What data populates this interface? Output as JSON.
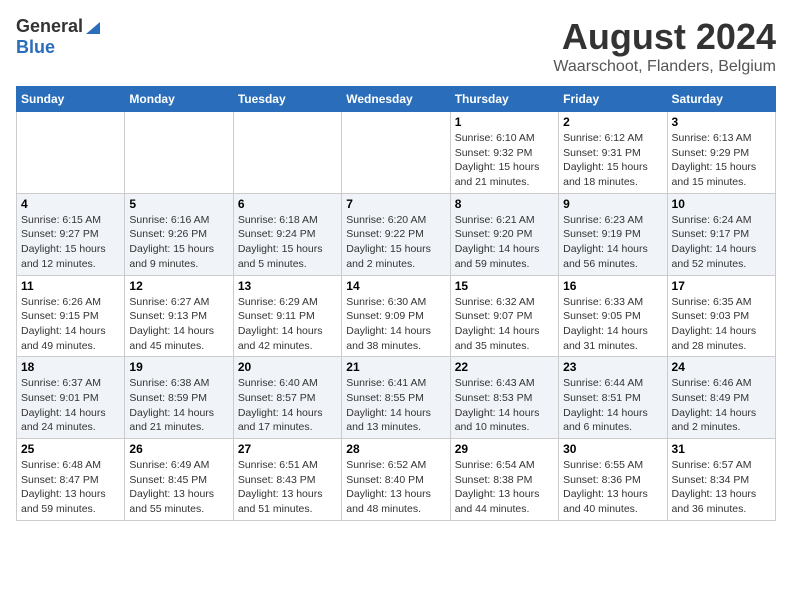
{
  "header": {
    "logo_general": "General",
    "logo_blue": "Blue",
    "month_title": "August 2024",
    "location": "Waarschoot, Flanders, Belgium"
  },
  "weekdays": [
    "Sunday",
    "Monday",
    "Tuesday",
    "Wednesday",
    "Thursday",
    "Friday",
    "Saturday"
  ],
  "weeks": [
    [
      {
        "day": "",
        "info": ""
      },
      {
        "day": "",
        "info": ""
      },
      {
        "day": "",
        "info": ""
      },
      {
        "day": "",
        "info": ""
      },
      {
        "day": "1",
        "info": "Sunrise: 6:10 AM\nSunset: 9:32 PM\nDaylight: 15 hours\nand 21 minutes."
      },
      {
        "day": "2",
        "info": "Sunrise: 6:12 AM\nSunset: 9:31 PM\nDaylight: 15 hours\nand 18 minutes."
      },
      {
        "day": "3",
        "info": "Sunrise: 6:13 AM\nSunset: 9:29 PM\nDaylight: 15 hours\nand 15 minutes."
      }
    ],
    [
      {
        "day": "4",
        "info": "Sunrise: 6:15 AM\nSunset: 9:27 PM\nDaylight: 15 hours\nand 12 minutes."
      },
      {
        "day": "5",
        "info": "Sunrise: 6:16 AM\nSunset: 9:26 PM\nDaylight: 15 hours\nand 9 minutes."
      },
      {
        "day": "6",
        "info": "Sunrise: 6:18 AM\nSunset: 9:24 PM\nDaylight: 15 hours\nand 5 minutes."
      },
      {
        "day": "7",
        "info": "Sunrise: 6:20 AM\nSunset: 9:22 PM\nDaylight: 15 hours\nand 2 minutes."
      },
      {
        "day": "8",
        "info": "Sunrise: 6:21 AM\nSunset: 9:20 PM\nDaylight: 14 hours\nand 59 minutes."
      },
      {
        "day": "9",
        "info": "Sunrise: 6:23 AM\nSunset: 9:19 PM\nDaylight: 14 hours\nand 56 minutes."
      },
      {
        "day": "10",
        "info": "Sunrise: 6:24 AM\nSunset: 9:17 PM\nDaylight: 14 hours\nand 52 minutes."
      }
    ],
    [
      {
        "day": "11",
        "info": "Sunrise: 6:26 AM\nSunset: 9:15 PM\nDaylight: 14 hours\nand 49 minutes."
      },
      {
        "day": "12",
        "info": "Sunrise: 6:27 AM\nSunset: 9:13 PM\nDaylight: 14 hours\nand 45 minutes."
      },
      {
        "day": "13",
        "info": "Sunrise: 6:29 AM\nSunset: 9:11 PM\nDaylight: 14 hours\nand 42 minutes."
      },
      {
        "day": "14",
        "info": "Sunrise: 6:30 AM\nSunset: 9:09 PM\nDaylight: 14 hours\nand 38 minutes."
      },
      {
        "day": "15",
        "info": "Sunrise: 6:32 AM\nSunset: 9:07 PM\nDaylight: 14 hours\nand 35 minutes."
      },
      {
        "day": "16",
        "info": "Sunrise: 6:33 AM\nSunset: 9:05 PM\nDaylight: 14 hours\nand 31 minutes."
      },
      {
        "day": "17",
        "info": "Sunrise: 6:35 AM\nSunset: 9:03 PM\nDaylight: 14 hours\nand 28 minutes."
      }
    ],
    [
      {
        "day": "18",
        "info": "Sunrise: 6:37 AM\nSunset: 9:01 PM\nDaylight: 14 hours\nand 24 minutes."
      },
      {
        "day": "19",
        "info": "Sunrise: 6:38 AM\nSunset: 8:59 PM\nDaylight: 14 hours\nand 21 minutes."
      },
      {
        "day": "20",
        "info": "Sunrise: 6:40 AM\nSunset: 8:57 PM\nDaylight: 14 hours\nand 17 minutes."
      },
      {
        "day": "21",
        "info": "Sunrise: 6:41 AM\nSunset: 8:55 PM\nDaylight: 14 hours\nand 13 minutes."
      },
      {
        "day": "22",
        "info": "Sunrise: 6:43 AM\nSunset: 8:53 PM\nDaylight: 14 hours\nand 10 minutes."
      },
      {
        "day": "23",
        "info": "Sunrise: 6:44 AM\nSunset: 8:51 PM\nDaylight: 14 hours\nand 6 minutes."
      },
      {
        "day": "24",
        "info": "Sunrise: 6:46 AM\nSunset: 8:49 PM\nDaylight: 14 hours\nand 2 minutes."
      }
    ],
    [
      {
        "day": "25",
        "info": "Sunrise: 6:48 AM\nSunset: 8:47 PM\nDaylight: 13 hours\nand 59 minutes."
      },
      {
        "day": "26",
        "info": "Sunrise: 6:49 AM\nSunset: 8:45 PM\nDaylight: 13 hours\nand 55 minutes."
      },
      {
        "day": "27",
        "info": "Sunrise: 6:51 AM\nSunset: 8:43 PM\nDaylight: 13 hours\nand 51 minutes."
      },
      {
        "day": "28",
        "info": "Sunrise: 6:52 AM\nSunset: 8:40 PM\nDaylight: 13 hours\nand 48 minutes."
      },
      {
        "day": "29",
        "info": "Sunrise: 6:54 AM\nSunset: 8:38 PM\nDaylight: 13 hours\nand 44 minutes."
      },
      {
        "day": "30",
        "info": "Sunrise: 6:55 AM\nSunset: 8:36 PM\nDaylight: 13 hours\nand 40 minutes."
      },
      {
        "day": "31",
        "info": "Sunrise: 6:57 AM\nSunset: 8:34 PM\nDaylight: 13 hours\nand 36 minutes."
      }
    ]
  ]
}
